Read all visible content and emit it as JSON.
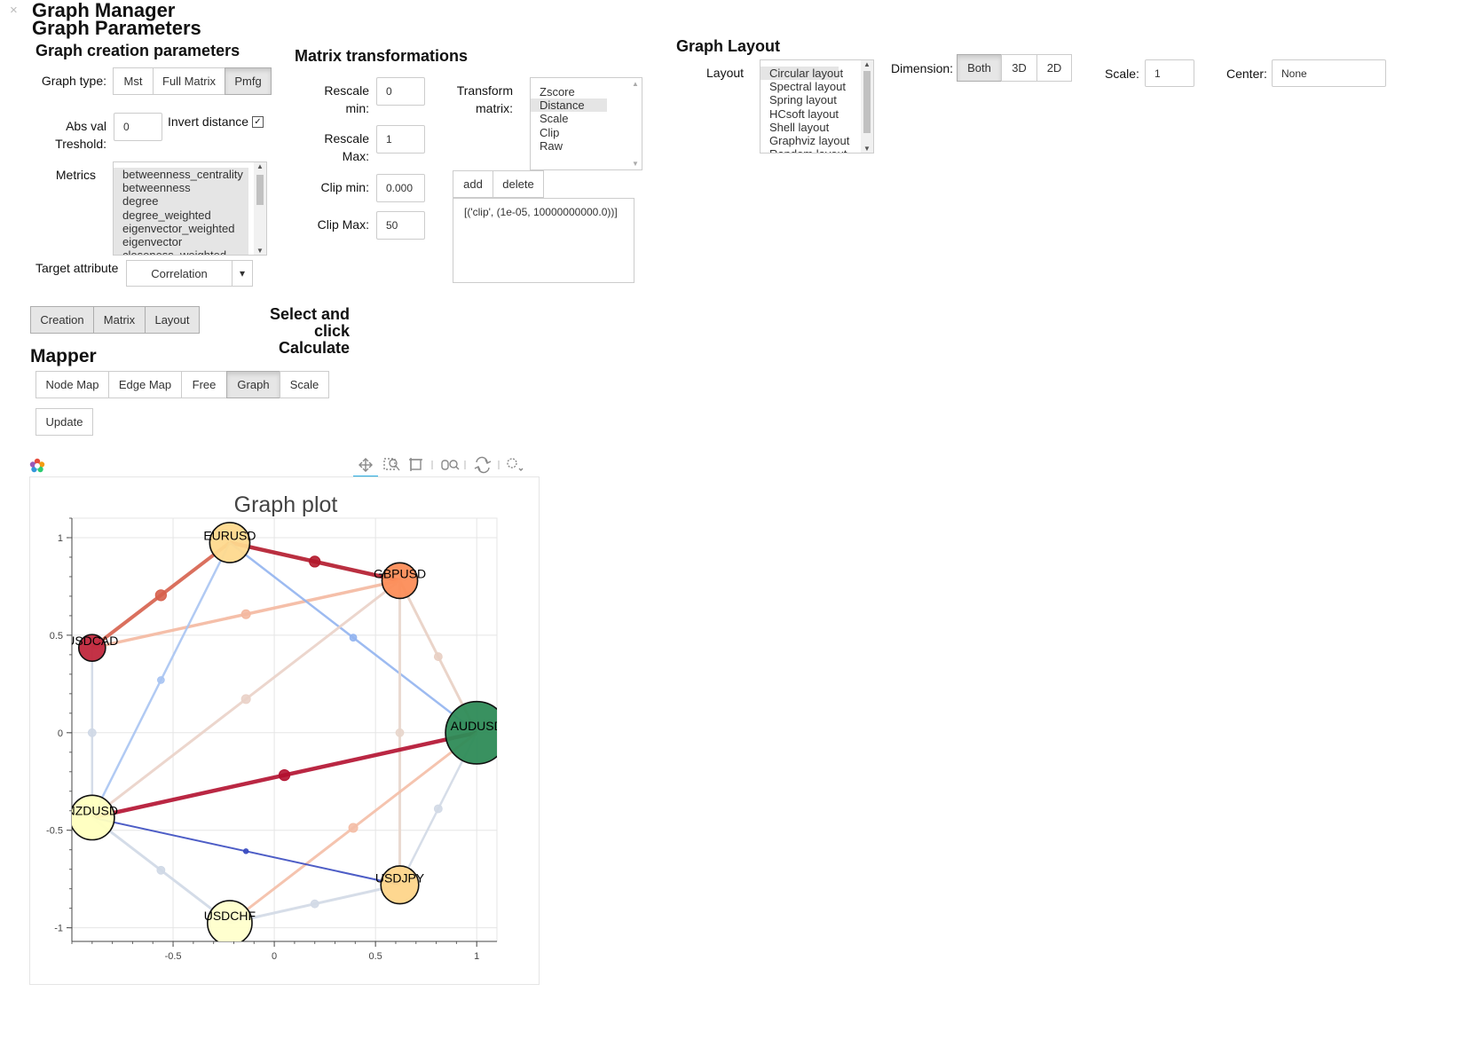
{
  "app": {
    "close_glyph": "×",
    "title": "Graph Manager",
    "subtitle": "Graph Parameters"
  },
  "creation": {
    "heading": "Graph creation parameters",
    "graph_type_label": "Graph type:",
    "graph_types": [
      "Mst",
      "Full Matrix",
      "Pmfg"
    ],
    "graph_type_selected": "Pmfg",
    "abs_val_label_1": "Abs val",
    "abs_val_label_2": "Treshold:",
    "abs_val_value": "0",
    "invert_label": "Invert distance",
    "invert_checked": true,
    "invert_glyph": "✓",
    "metrics_label": "Metrics",
    "metrics": [
      "betweenness_centrality",
      "betweenness",
      "degree",
      "degree_weighted",
      "eigenvector_weighted",
      "eigenvector",
      "closeness_weighted"
    ],
    "target_label": "Target attribute",
    "target_value": "Correlation",
    "dropdown_glyph": "▾"
  },
  "matrix": {
    "heading": "Matrix transformations",
    "rescale_min_label_1": "Rescale",
    "rescale_min_label_2": "min:",
    "rescale_min_value": "0",
    "rescale_max_label_1": "Rescale",
    "rescale_max_label_2": "Max:",
    "rescale_max_value": "1",
    "clip_min_label": "Clip min:",
    "clip_min_value": "0.000",
    "clip_max_label": "Clip Max:",
    "clip_max_value": "50",
    "transform_label_1": "Transform",
    "transform_label_2": "matrix:",
    "transforms": [
      "Zscore",
      "Distance",
      "Scale",
      "Clip",
      "Raw"
    ],
    "transform_selected": "Distance",
    "add_label": "add",
    "delete_label": "delete",
    "pipeline_text": "[('clip', (1e-05, 10000000000.0))]"
  },
  "layout": {
    "heading": "Graph Layout",
    "layout_label": "Layout",
    "layouts": [
      "Circular layout",
      "Spectral layout",
      "Spring layout",
      "HCsoft layout",
      "Shell layout",
      "Graphviz layout",
      "Random layout"
    ],
    "layout_selected": "Circular layout",
    "dimension_label": "Dimension:",
    "dimensions": [
      "Both",
      "3D",
      "2D"
    ],
    "dimension_selected": "Both",
    "scale_label": "Scale:",
    "scale_value": "1",
    "center_label": "Center:",
    "center_value": "None"
  },
  "tabs": {
    "items": [
      "Creation",
      "Matrix",
      "Layout"
    ],
    "hint_1": "Select and click",
    "hint_2": "Calculate"
  },
  "mapper": {
    "heading": "Mapper",
    "tabs": [
      "Node Map",
      "Edge Map",
      "Free",
      "Graph",
      "Scale"
    ],
    "selected": "Graph",
    "update_label": "Update"
  },
  "toolbar": {
    "icons": [
      "bokeh-logo-icon",
      "pan-icon",
      "zoom-icon",
      "box-zoom-icon",
      "wheel-zoom-icon",
      "reset-icon",
      "hover-icon"
    ]
  },
  "chart_data": {
    "type": "network",
    "title": "Graph plot",
    "xlim": [
      -1.0,
      1.1
    ],
    "ylim": [
      -1.07,
      1.1
    ],
    "x_ticks": [
      "-0.5",
      "0",
      "0.5",
      "1"
    ],
    "y_ticks": [
      "1",
      "0.5",
      "0",
      "-0.5",
      "-1"
    ],
    "x_tick_values": [
      -0.5,
      0,
      0.5,
      1
    ],
    "y_tick_values": [
      1,
      0.5,
      0,
      -0.5,
      -1
    ],
    "grid": true,
    "nodes": [
      {
        "label": "EURUSD",
        "x": -0.22,
        "y": 0.975,
        "size": 0.09,
        "color": "#fed98e"
      },
      {
        "label": "GBPUSD",
        "x": 0.62,
        "y": 0.78,
        "size": 0.08,
        "color": "#fc8d59"
      },
      {
        "label": "USDCAD",
        "x": -0.9,
        "y": 0.435,
        "size": 0.06,
        "color": "#c0273c"
      },
      {
        "label": "AUDUSD",
        "x": 1.0,
        "y": 0.0,
        "size": 0.14,
        "color": "#2e8b57"
      },
      {
        "label": "NZDUSD",
        "x": -0.9,
        "y": -0.435,
        "size": 0.1,
        "color": "#ffffbf"
      },
      {
        "label": "USDJPY",
        "x": 0.62,
        "y": -0.78,
        "size": 0.085,
        "color": "#fed58a"
      },
      {
        "label": "USDCHF",
        "x": -0.22,
        "y": -0.975,
        "size": 0.1,
        "color": "#ffffcc"
      }
    ],
    "edges": [
      {
        "source": "USDCAD",
        "target": "EURUSD",
        "color": "#d6604d",
        "width": 4
      },
      {
        "source": "EURUSD",
        "target": "GBPUSD",
        "color": "#b2182b",
        "width": 4.5
      },
      {
        "source": "USDCAD",
        "target": "GBPUSD",
        "color": "#f4b8a0",
        "width": 3.5
      },
      {
        "source": "EURUSD",
        "target": "AUDUSD",
        "color": "#92b4f0",
        "width": 2.5
      },
      {
        "source": "NZDUSD",
        "target": "EURUSD",
        "color": "#a8c4f2",
        "width": 2.5
      },
      {
        "source": "NZDUSD",
        "target": "GBPUSD",
        "color": "#ead2c8",
        "width": 3
      },
      {
        "source": "GBPUSD",
        "target": "AUDUSD",
        "color": "#e8cfc3",
        "width": 3
      },
      {
        "source": "GBPUSD",
        "target": "USDJPY",
        "color": "#e8d6cc",
        "width": 3
      },
      {
        "source": "USDCAD",
        "target": "NZDUSD",
        "color": "#cfd8e6",
        "width": 2.5
      },
      {
        "source": "NZDUSD",
        "target": "AUDUSD",
        "color": "#b2102f",
        "width": 4.5
      },
      {
        "source": "AUDUSD",
        "target": "USDJPY",
        "color": "#d2d9e6",
        "width": 2.5
      },
      {
        "source": "USDCHF",
        "target": "AUDUSD",
        "color": "#f4bea6",
        "width": 3
      },
      {
        "source": "NZDUSD",
        "target": "USDJPY",
        "color": "#3a4bc0",
        "width": 2
      },
      {
        "source": "NZDUSD",
        "target": "USDCHF",
        "color": "#cfd8e6",
        "width": 3
      },
      {
        "source": "USDCHF",
        "target": "USDJPY",
        "color": "#d2d9e6",
        "width": 3
      }
    ],
    "edge_midpoint_sizes": [
      0.045,
      0.045,
      0.035,
      0.025,
      0.025,
      0.035,
      0.03,
      0.03,
      0.03,
      0.045,
      0.03,
      0.035,
      0.015,
      0.03,
      0.03
    ]
  }
}
